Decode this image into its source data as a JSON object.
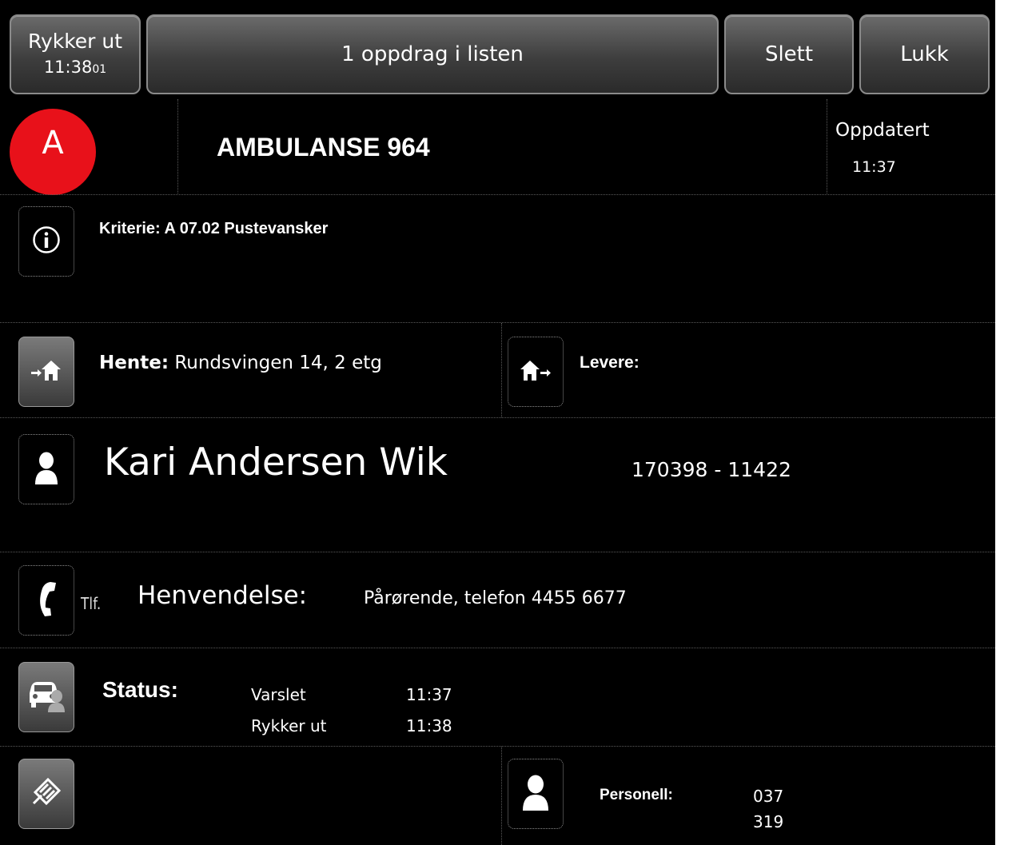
{
  "top_bar": {
    "status_button": {
      "label": "Rykker ut",
      "time_main": "11:38",
      "time_seconds": "01"
    },
    "list_button": {
      "label": "1 oppdrag i listen"
    },
    "delete_button": {
      "label": "Slett"
    },
    "close_button": {
      "label": "Lukk"
    }
  },
  "header": {
    "priority_badge": "A",
    "priority_color": "#e8111a",
    "unit_title": "AMBULANSE 964",
    "updated_label": "Oppdatert",
    "updated_time": "11:37"
  },
  "info": {
    "criteria_text": "Kriterie: A 07.02  Pustevansker",
    "icon": "info-icon"
  },
  "pickup": {
    "label": "Hente:",
    "value": "Rundsvingen 14, 2 etg",
    "icon": "house-pickup-icon"
  },
  "dropoff": {
    "label": "Levere:",
    "value": "",
    "icon": "house-dropoff-icon"
  },
  "patient": {
    "name": "Kari Andersen Wik",
    "id_number": "170398 - 11422",
    "icon": "person-icon"
  },
  "contact": {
    "tlf_label": "Tlf.",
    "label": "Henvendelse:",
    "value": "Pårørende, telefon 4455 6677",
    "icon": "phone-icon"
  },
  "status": {
    "label": "Status:",
    "icon": "vehicle-status-icon",
    "entries": [
      {
        "name": "Varslet",
        "time": "11:37"
      },
      {
        "name": "Rykker ut",
        "time": "11:38"
      }
    ]
  },
  "bottom": {
    "notes_icon": "notes-icon",
    "personnel_label": "Personell:",
    "personnel": [
      "037",
      "319"
    ],
    "personnel_icon": "person-icon"
  }
}
